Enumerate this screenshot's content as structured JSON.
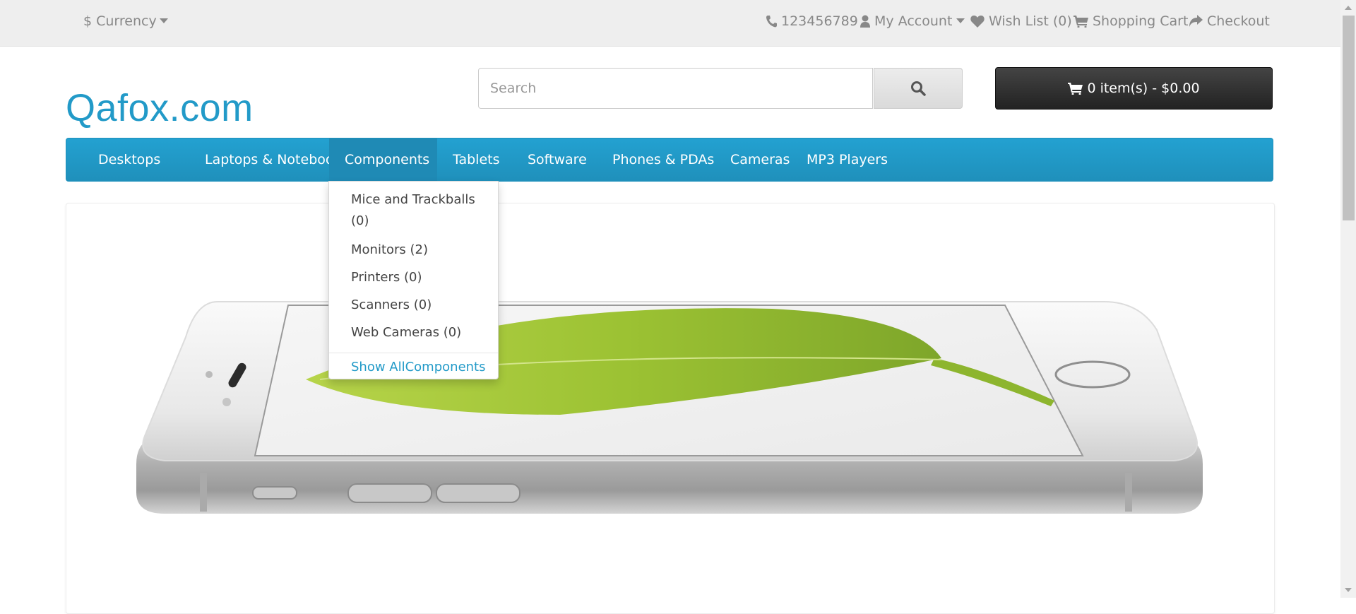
{
  "topbar": {
    "currency": "Currency",
    "phone": "123456789",
    "my_account": "My Account",
    "wish_list": "Wish List (0)",
    "shopping_cart": "Shopping Cart",
    "checkout": "Checkout"
  },
  "header": {
    "logo": "Qafox.com",
    "search_placeholder": "Search",
    "cart_label": "0 item(s) - $0.00"
  },
  "nav": {
    "items": [
      {
        "label": "Desktops"
      },
      {
        "label": "Laptops & Notebooks"
      },
      {
        "label": "Components"
      },
      {
        "label": "Tablets"
      },
      {
        "label": "Software"
      },
      {
        "label": "Phones & PDAs"
      },
      {
        "label": "Cameras"
      },
      {
        "label": "MP3 Players"
      }
    ],
    "active": "Components"
  },
  "dropdown": {
    "items": [
      {
        "label": "Mice and Trackballs (0)"
      },
      {
        "label": "Monitors (2)"
      },
      {
        "label": "Printers (0)"
      },
      {
        "label": "Scanners (0)"
      },
      {
        "label": "Web Cameras (0)"
      }
    ],
    "show_all": "Show AllComponents"
  },
  "colors": {
    "brand": "#229ac8",
    "nav_bg": "#229ac8",
    "cart_bg": "#363636",
    "topbar_bg": "#eeeeee"
  },
  "icons": [
    "dollar-icon",
    "caret-down-icon",
    "phone-icon",
    "user-icon",
    "heart-icon",
    "cart-icon",
    "share-icon",
    "search-icon"
  ]
}
